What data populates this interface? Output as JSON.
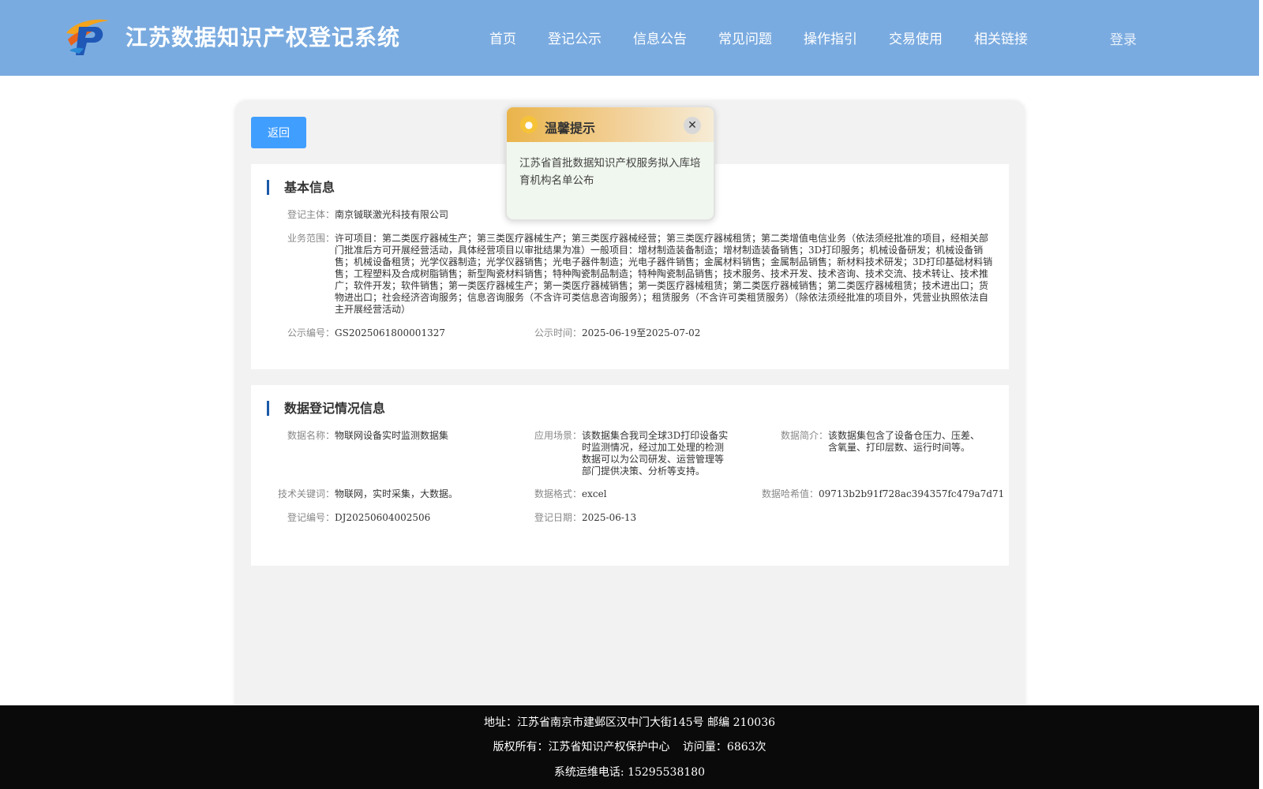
{
  "header": {
    "site_title": "江苏数据知识产权登记系统",
    "nav": [
      {
        "label": "首页"
      },
      {
        "label": "登记公示"
      },
      {
        "label": "信息公告"
      },
      {
        "label": "常见问题"
      },
      {
        "label": "操作指引"
      },
      {
        "label": "交易使用"
      },
      {
        "label": "相关链接"
      }
    ],
    "login_label": "登录"
  },
  "main": {
    "back_label": "返回",
    "basic": {
      "title": "基本信息",
      "subject_label": "登记主体：",
      "subject_value": "南京铖联激光科技有限公司",
      "scope_label": "业务范围：",
      "scope_value": "许可项目：第二类医疗器械生产；第三类医疗器械生产；第三类医疗器械经营；第三类医疗器械租赁；第二类增值电信业务（依法须经批准的项目，经相关部门批准后方可开展经营活动，具体经营项目以审批结果为准）一般项目：增材制造装备制造；增材制造装备销售；3D打印服务；机械设备研发；机械设备销售；机械设备租赁；光学仪器制造；光学仪器销售；光电子器件制造；光电子器件销售；金属材料销售；金属制品销售；新材料技术研发；3D打印基础材料销售；工程塑料及合成树脂销售；新型陶瓷材料销售；特种陶瓷制品制造；特种陶瓷制品销售；技术服务、技术开发、技术咨询、技术交流、技术转让、技术推广；软件开发；软件销售；第一类医疗器械生产；第一类医疗器械销售；第一类医疗器械租赁；第二类医疗器械销售；第二类医疗器械租赁；技术进出口；货物进出口；社会经济咨询服务；信息咨询服务（不含许可类信息咨询服务）；租赁服务（不含许可类租赁服务）（除依法须经批准的项目外，凭营业执照依法自主开展经营活动）",
      "pub_no_label": "公示编号：",
      "pub_no_value": "GS2025061800001327",
      "pub_time_label": "公示时间：",
      "pub_time_value": "2025-06-19至2025-07-02"
    },
    "data_info": {
      "title": "数据登记情况信息",
      "name_label": "数据名称：",
      "name_value": "物联网设备实时监测数据集",
      "scene_label": "应用场景：",
      "scene_value": "该数据集合我司全球3D打印设备实时监测情况，经过加工处理的检测数据可以为公司研发、运营管理等部门提供决策、分析等支持。",
      "intro_label": "数据简介：",
      "intro_value": "该数据集包含了设备仓压力、压差、含氧量、打印层数、运行时间等。",
      "keyword_label": "技术关键词：",
      "keyword_value": "物联网，实时采集，大数据。",
      "format_label": "数据格式：",
      "format_value": "excel",
      "hash_label": "数据哈希值：",
      "hash_value": "09713b2b91f728ac394357fc479a7d71",
      "reg_no_label": "登记编号：",
      "reg_no_value": "DJ20250604002506",
      "reg_date_label": "登记日期：",
      "reg_date_value": "2025-06-13"
    }
  },
  "popup": {
    "title": "温馨提示",
    "icon": "lightbulb-icon",
    "body": "江苏省首批数据知识产权服务拟入库培育机构名单公布"
  },
  "footer": {
    "address": "地址：江苏省南京市建邺区汉中门大街145号 邮编 210036",
    "copyright": "版权所有：江苏省知识产权保护中心",
    "visits": "访问量：6863次",
    "phone": "系统运维电话: 15295538180"
  },
  "colors": {
    "header_bg": "#7aabe0",
    "button_blue": "#409eff",
    "section_accent": "#1c5aa8",
    "footer_bg": "#0a0a0a"
  }
}
